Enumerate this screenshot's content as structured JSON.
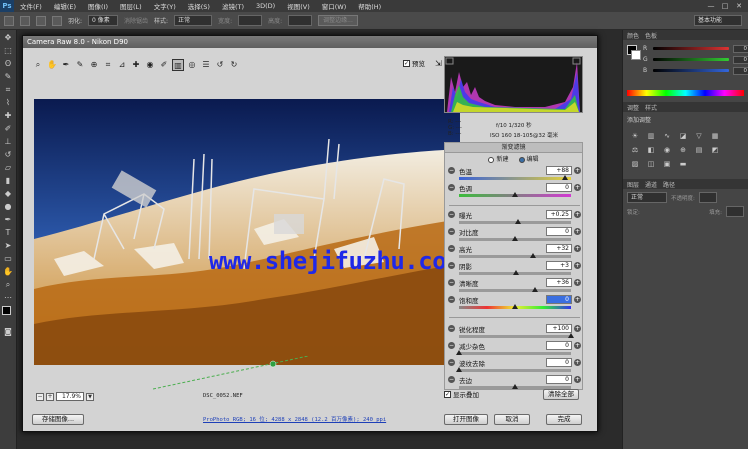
{
  "app": {
    "logo": "Ps",
    "menus": [
      "文件(F)",
      "编辑(E)",
      "图像(I)",
      "图层(L)",
      "文字(Y)",
      "选择(S)",
      "滤镜(T)",
      "3D(D)",
      "视图(V)",
      "窗口(W)",
      "帮助(H)"
    ],
    "window_controls": [
      "—",
      "□",
      "✕"
    ]
  },
  "options_bar": {
    "feather_label": "羽化:",
    "feather_value": "0 像素",
    "antialias_label": "消除锯齿",
    "style_label": "样式:",
    "style_value": "正常",
    "width_label": "宽度:",
    "height_label": "高度:",
    "refine_label": "调整边缘...",
    "workspace": "基本功能"
  },
  "dialog": {
    "title": "Camera Raw 8.0 - Nikon D90",
    "preview_label": "预览",
    "preview_checked": true,
    "watermark": "www.shejifuzhu.com",
    "filename": "DSC_0052.NEF",
    "zoom": "17.9%",
    "camera_info": {
      "r": "R:",
      "g": "G:",
      "b": "B:",
      "r_val": "---",
      "g_val": "---",
      "b_val": "---",
      "aperture_shutter": "f/10  1/320 秒",
      "iso_lens": "ISO 160  18-105@32 毫米"
    },
    "panel_title": "渐变滤镜",
    "mode_new": "新建",
    "mode_edit": "编辑",
    "mode_selected": "edit",
    "sliders": [
      {
        "label": "色温",
        "value": "+88",
        "pos": 0.95
      },
      {
        "label": "色调",
        "value": "0",
        "pos": 0.5
      },
      {
        "label": "曝光",
        "value": "+0.25",
        "pos": 0.53
      },
      {
        "label": "对比度",
        "value": "0",
        "pos": 0.5
      },
      {
        "label": "高光",
        "value": "+32",
        "pos": 0.66
      },
      {
        "label": "阴影",
        "value": "+3",
        "pos": 0.51
      },
      {
        "label": "清晰度",
        "value": "+36",
        "pos": 0.68
      },
      {
        "label": "饱和度",
        "value": "0",
        "pos": 0.5
      },
      {
        "label": "锐化程度",
        "value": "+100",
        "pos": 1.0
      },
      {
        "label": "减少杂色",
        "value": "0",
        "pos": 0.0
      },
      {
        "label": "波纹去除",
        "value": "0",
        "pos": 0.0
      },
      {
        "label": "去边",
        "value": "0",
        "pos": 0.5
      }
    ],
    "overlay_label": "显示叠加",
    "clear_all": "清除全部",
    "save_image": "存储图像...",
    "workflow_link": "ProPhoto RGB; 16 位; 4288 x 2848 (12.2 百万像素); 240 ppi",
    "open_image": "打开图像",
    "cancel": "取消",
    "done": "完成"
  },
  "right_panel": {
    "color_tabs": [
      "颜色",
      "色板"
    ],
    "channels": [
      {
        "ch": "R",
        "value": "0",
        "color": "#d33"
      },
      {
        "ch": "G",
        "value": "0",
        "color": "#3c3"
      },
      {
        "ch": "B",
        "value": "0",
        "color": "#36d"
      }
    ],
    "adjust_tabs": [
      "调整",
      "样式"
    ],
    "adjust_title": "添加调整",
    "layers_tabs": [
      "图层",
      "通道",
      "路径"
    ],
    "blend_mode": "正常",
    "opacity_label": "不透明度:",
    "lock_label": "锁定:",
    "fill_label": "填充:"
  }
}
